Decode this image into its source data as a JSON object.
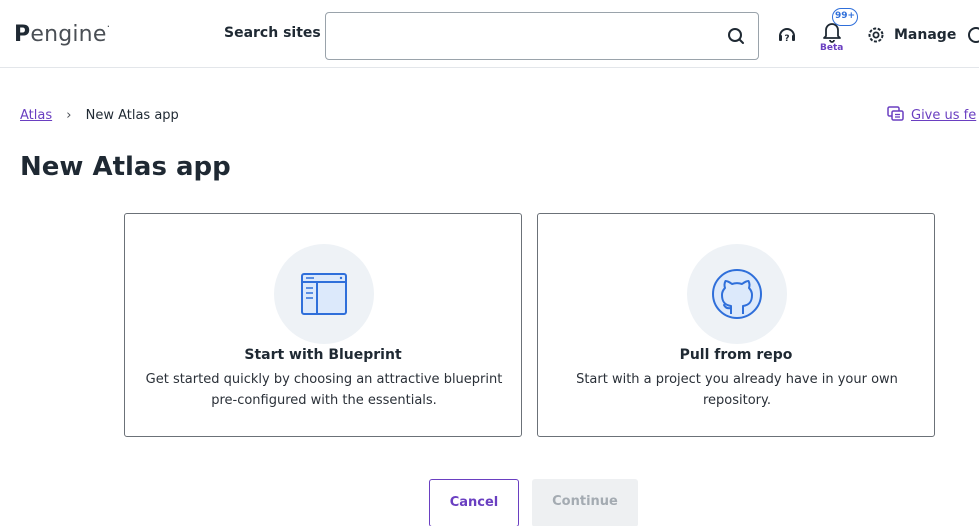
{
  "header": {
    "logo_prefix": "P",
    "logo_text": "engine",
    "logo_mark": "·",
    "search_label": "Search sites",
    "search_value": "",
    "search_placeholder": "",
    "notifications_count": "99+",
    "beta_label": "Beta",
    "manage_label": "Manage",
    "icons": {
      "search": "search-icon",
      "help": "help-icon",
      "bell": "bell-icon",
      "gear": "gear-icon"
    }
  },
  "breadcrumb": {
    "root": "Atlas",
    "separator": "›",
    "current": "New Atlas app"
  },
  "feedback_label": "Give us fe",
  "page_title": "New Atlas app",
  "cards": [
    {
      "title": "Start with Blueprint",
      "description": "Get started quickly by choosing an attractive blueprint pre-configured with the essentials.",
      "icon": "blueprint-icon"
    },
    {
      "title": "Pull from repo",
      "description": "Start with a project you already have in your own repository.",
      "icon": "github-icon"
    }
  ],
  "actions": {
    "cancel_label": "Cancel",
    "continue_label": "Continue"
  },
  "colors": {
    "accent": "#6a3fc1",
    "badge": "#2f6fda",
    "icon_blue": "#2f6fda",
    "icon_circle": "#eef2f6",
    "disabled_bg": "#eef0f2",
    "disabled_text": "#a4abb2"
  }
}
